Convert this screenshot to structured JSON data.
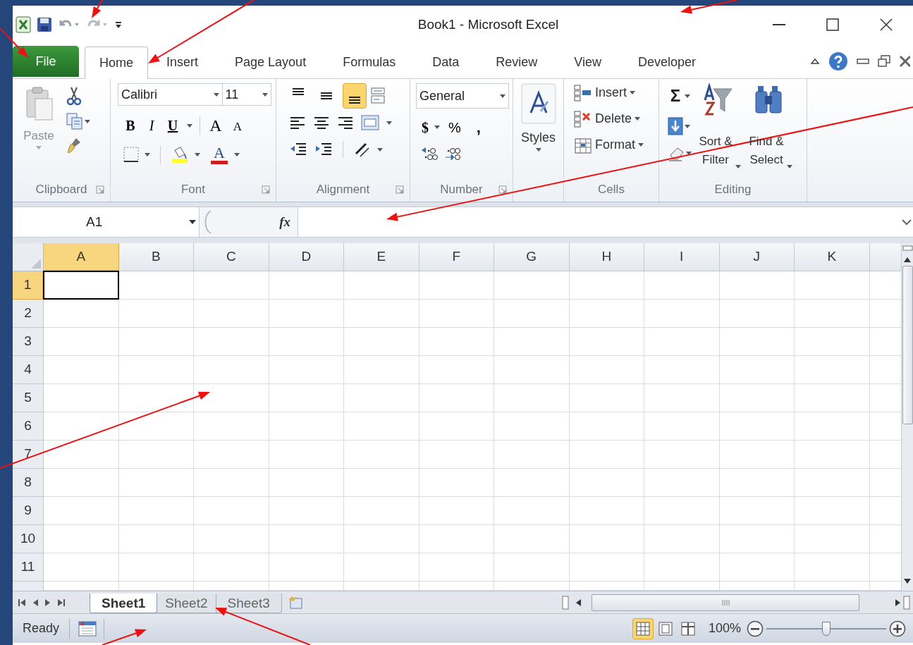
{
  "window": {
    "title": "Book1 - Microsoft Excel"
  },
  "tabs": [
    {
      "label": "File",
      "kind": "file",
      "selected": false
    },
    {
      "label": "Home",
      "kind": "tab",
      "selected": true
    },
    {
      "label": "Insert",
      "kind": "tab",
      "selected": false
    },
    {
      "label": "Page Layout",
      "kind": "tab",
      "selected": false
    },
    {
      "label": "Formulas",
      "kind": "tab",
      "selected": false
    },
    {
      "label": "Data",
      "kind": "tab",
      "selected": false
    },
    {
      "label": "Review",
      "kind": "tab",
      "selected": false
    },
    {
      "label": "View",
      "kind": "tab",
      "selected": false
    },
    {
      "label": "Developer",
      "kind": "tab",
      "selected": false
    }
  ],
  "ribbon": {
    "clipboard": {
      "label": "Clipboard",
      "paste": "Paste"
    },
    "font": {
      "label": "Font",
      "family": "Calibri",
      "size": "11",
      "bold": "B",
      "italic": "I",
      "underline": "U",
      "grow": "A",
      "shrink": "A",
      "font_color": "A"
    },
    "alignment": {
      "label": "Alignment",
      "vertical": [
        {
          "selected": false
        },
        {
          "selected": false
        },
        {
          "selected": true
        }
      ]
    },
    "number": {
      "label": "Number",
      "format": "General",
      "currency": "$",
      "percent": "%",
      "comma": ","
    },
    "styles": {
      "label": "Styles"
    },
    "cells": {
      "label": "Cells",
      "buttons": [
        "Insert",
        "Delete",
        "Format"
      ]
    },
    "editing": {
      "label": "Editing",
      "sum": "Σ",
      "sort": "Sort & Filter",
      "find": "Find & Select"
    }
  },
  "formula_bar": {
    "name_box": "A1",
    "fx": "fx"
  },
  "columns": [
    {
      "label": "A",
      "selected": true
    },
    {
      "label": "B",
      "selected": false
    },
    {
      "label": "C",
      "selected": false
    },
    {
      "label": "D",
      "selected": false
    },
    {
      "label": "E",
      "selected": false
    },
    {
      "label": "F",
      "selected": false
    },
    {
      "label": "G",
      "selected": false
    },
    {
      "label": "H",
      "selected": false
    },
    {
      "label": "I",
      "selected": false
    },
    {
      "label": "J",
      "selected": false
    },
    {
      "label": "K",
      "selected": false
    }
  ],
  "rows": [
    {
      "label": "1",
      "selected": true
    },
    {
      "label": "2",
      "selected": false
    },
    {
      "label": "3",
      "selected": false
    },
    {
      "label": "4",
      "selected": false
    },
    {
      "label": "5",
      "selected": false
    },
    {
      "label": "6",
      "selected": false
    },
    {
      "label": "7",
      "selected": false
    },
    {
      "label": "8",
      "selected": false
    },
    {
      "label": "9",
      "selected": false
    },
    {
      "label": "10",
      "selected": false
    },
    {
      "label": "11",
      "selected": false
    }
  ],
  "sheet_tabs": [
    {
      "label": "Sheet1",
      "selected": true
    },
    {
      "label": "Sheet2",
      "selected": false
    },
    {
      "label": "Sheet3",
      "selected": false
    }
  ],
  "status_bar": {
    "status": "Ready",
    "views": [
      {
        "kind": "normal",
        "selected": true
      },
      {
        "kind": "page_layout",
        "selected": false
      },
      {
        "kind": "page_break",
        "selected": false
      }
    ],
    "zoom": "100%",
    "zoom_slider": {
      "level": 0.5
    }
  }
}
